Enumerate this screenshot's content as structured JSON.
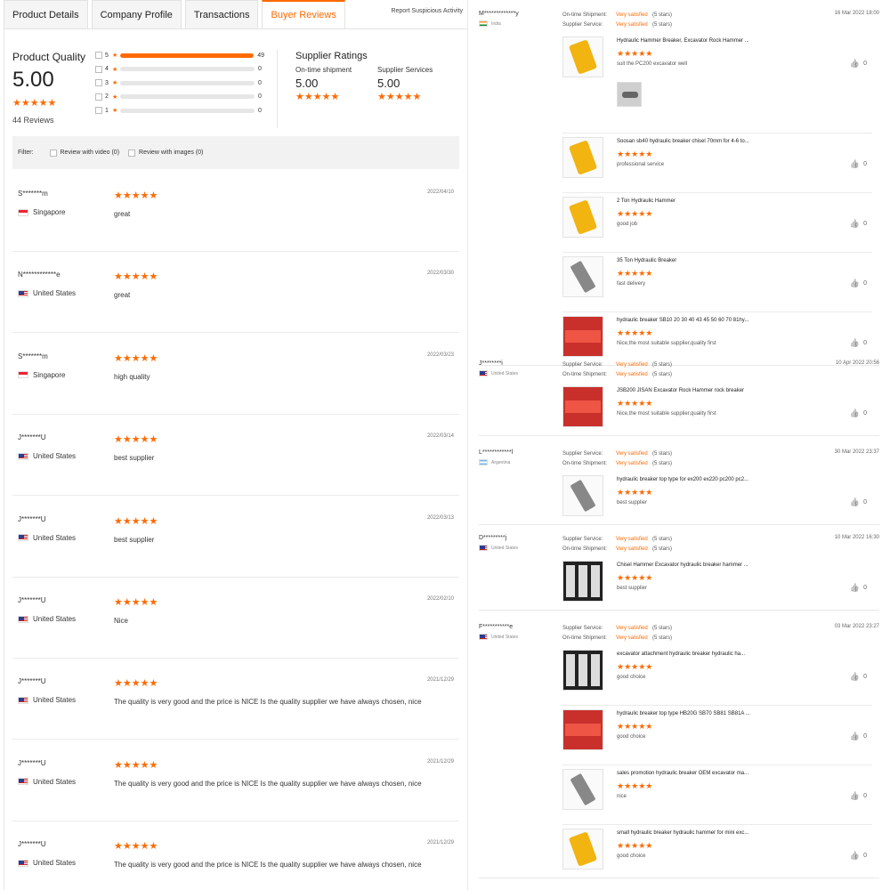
{
  "tabs": [
    {
      "label": "Product Details"
    },
    {
      "label": "Company Profile"
    },
    {
      "label": "Transactions"
    },
    {
      "label": "Buyer Reviews",
      "active": true
    }
  ],
  "report_link": "Report Suspicious Activity",
  "product_quality": {
    "label": "Product Quality",
    "score": "5.00",
    "reviews_count": "44 Reviews",
    "distribution": [
      {
        "stars": "5",
        "count": "49",
        "fraction": 1.0
      },
      {
        "stars": "4",
        "count": "0",
        "fraction": 0
      },
      {
        "stars": "3",
        "count": "0",
        "fraction": 0
      },
      {
        "stars": "2",
        "count": "0",
        "fraction": 0
      },
      {
        "stars": "1",
        "count": "0",
        "fraction": 0
      }
    ]
  },
  "supplier_ratings": {
    "title": "Supplier Ratings",
    "shipment_label": "On-time shipment",
    "shipment_score": "5.00",
    "services_label": "Supplier Services",
    "services_score": "5.00"
  },
  "filter": {
    "label": "Filter:",
    "video": "Review with video (0)",
    "images": "Review with images (0)"
  },
  "reviews": [
    {
      "user": "S*******m",
      "country": "Singapore",
      "flag": "sg",
      "text": "great",
      "date": "2022/04/10"
    },
    {
      "user": "N************e",
      "country": "United States",
      "flag": "us",
      "text": "great",
      "date": "2022/03/30"
    },
    {
      "user": "S*******m",
      "country": "Singapore",
      "flag": "sg",
      "text": "high quality",
      "date": "2022/03/23"
    },
    {
      "user": "J*******U",
      "country": "United States",
      "flag": "us",
      "text": "best supplier",
      "date": "2022/03/14"
    },
    {
      "user": "J*******U",
      "country": "United States",
      "flag": "us",
      "text": "best supplier",
      "date": "2022/03/13"
    },
    {
      "user": "J*******U",
      "country": "United States",
      "flag": "us",
      "text": "Nice",
      "date": "2022/02/10"
    },
    {
      "user": "J*******U",
      "country": "United States",
      "flag": "us",
      "text": "The quality is very good and the price is NICE Is the quality supplier we have always chosen, nice",
      "date": "2021/12/29"
    },
    {
      "user": "J*******U",
      "country": "United States",
      "flag": "us",
      "text": "The quality is very good and the price is NICE Is the quality supplier we have always chosen, nice",
      "date": "2021/12/29"
    },
    {
      "user": "J*******U",
      "country": "United States",
      "flag": "us",
      "text": "The quality is very good and the price is NICE Is the quality supplier we have always chosen, nice",
      "date": "2021/12/29"
    }
  ],
  "orders": [
    {
      "user": "M*************y",
      "country": "India",
      "flag": "in",
      "date": "16 Mar 2022 18:00",
      "ratings": [
        {
          "label": "On-time Shipment:",
          "value": "Very satisfied",
          "sub": "(5 stars)"
        },
        {
          "label": "Supplier Service:",
          "value": "Very satisfied",
          "sub": "(5 stars)"
        }
      ],
      "items": [
        {
          "title": "Hydraulic Hammer Breaker, Excavator Rock Hammer ...",
          "text": "suit the PC200 excavator well",
          "likes": "0",
          "img": "y",
          "attach": true
        },
        {
          "title": "Soosan sb40 hydraulic breaker chisel 70mm for 4-6 to...",
          "text": "professional service",
          "likes": "0",
          "img": "y"
        },
        {
          "title": "2 Ton Hydraulic Hammer",
          "text": "good job",
          "likes": "0",
          "img": "y"
        },
        {
          "title": "35 Ton Hydraulic Breaker",
          "text": "fast delivery",
          "likes": "0",
          "img": "g"
        },
        {
          "title": "hydraulic breaker SB10 20 30 40 43 45 50 60 70 81hy...",
          "text": "Nice,the most suitable supplier,quality first",
          "likes": "0",
          "img": "r"
        }
      ]
    },
    {
      "user": "J********i",
      "country": "United States",
      "flag": "us",
      "date": "10 Apr 2022 20:56",
      "ratings": [
        {
          "label": "Supplier Service:",
          "value": "Very satisfied",
          "sub": "(5 stars)"
        },
        {
          "label": "On-time Shipment:",
          "value": "Very satisfied",
          "sub": "(5 stars)"
        }
      ],
      "items": [
        {
          "title": "JSB200 JISAN Excavator Rock Hammer rock breaker",
          "text": "Nice,the most suitable supplier,quality first",
          "likes": "0",
          "img": "r"
        }
      ]
    },
    {
      "user": "L************l",
      "country": "Argentina",
      "flag": "ar",
      "date": "30 Mar 2022 23:37",
      "ratings": [
        {
          "label": "Supplier Service:",
          "value": "Very satisfied",
          "sub": "(5 stars)"
        },
        {
          "label": "On-time Shipment:",
          "value": "Very satisfied",
          "sub": "(5 stars)"
        }
      ],
      "items": [
        {
          "title": "hydraulic breaker top type for ex200 ex220 pc200 pc2...",
          "text": "best supplier",
          "likes": "0",
          "img": "g"
        }
      ]
    },
    {
      "user": "D*********j",
      "country": "United States",
      "flag": "us",
      "date": "10 Mar 2022 16:30",
      "ratings": [
        {
          "label": "Supplier Service:",
          "value": "Very satisfied",
          "sub": "(5 stars)"
        },
        {
          "label": "On-time Shipment:",
          "value": "Very satisfied",
          "sub": "(5 stars)"
        }
      ],
      "items": [
        {
          "title": "Chisel Hammer Excavator hydraulic breaker hammer ...",
          "text": "best supplier",
          "likes": "0",
          "img": "k"
        }
      ]
    },
    {
      "user": "F***********e",
      "country": "United States",
      "flag": "us",
      "date": "03 Mar 2022 23:27",
      "ratings": [
        {
          "label": "Supplier Service:",
          "value": "Very satisfied",
          "sub": "(5 stars)"
        },
        {
          "label": "On-time Shipment:",
          "value": "Very satisfied",
          "sub": "(5 stars)"
        }
      ],
      "items": [
        {
          "title": "excavator attachment hydraulic breaker hydraulic ha...",
          "text": "good choice",
          "likes": "0",
          "img": "k"
        },
        {
          "title": "hydraulic breaker top type HB20G SB70 SB81 SB81A ...",
          "text": "good choice",
          "likes": "0",
          "img": "r"
        },
        {
          "title": "sales promotion hydraulic breaker OEM excavator ma...",
          "text": "nice",
          "likes": "0",
          "img": "g"
        },
        {
          "title": "small hydraulic breaker hydraulic hammer for mini exc...",
          "text": "good choice",
          "likes": "0",
          "img": "y"
        }
      ]
    }
  ]
}
